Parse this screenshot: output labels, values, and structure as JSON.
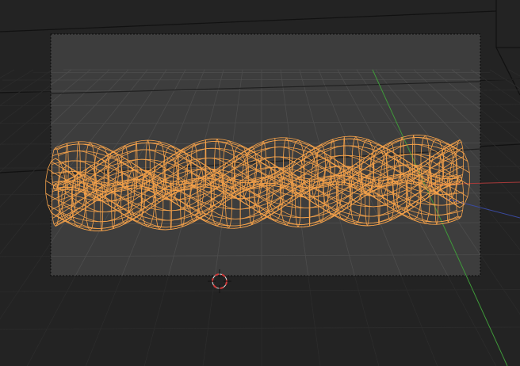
{
  "viewport": {
    "mode": "wireframe",
    "selected_object": "braid-mesh",
    "object_state": "selected"
  },
  "colors": {
    "background": "#232323",
    "camera_frame_fill": "#3d3d3d",
    "camera_frame_border": "#0a0a0a",
    "grid": "#4a4a4a",
    "grid_dark": "#2c2c2c",
    "axis_y": "#3f9a3a",
    "axis_x": "#a83a3a",
    "axis_z": "#3a4aa0",
    "wire": "#f4a14a",
    "cursor_red": "#d23a3a",
    "cursor_white": "#e6e6e6"
  },
  "icons": {
    "cursor": "3d-cursor-icon"
  }
}
